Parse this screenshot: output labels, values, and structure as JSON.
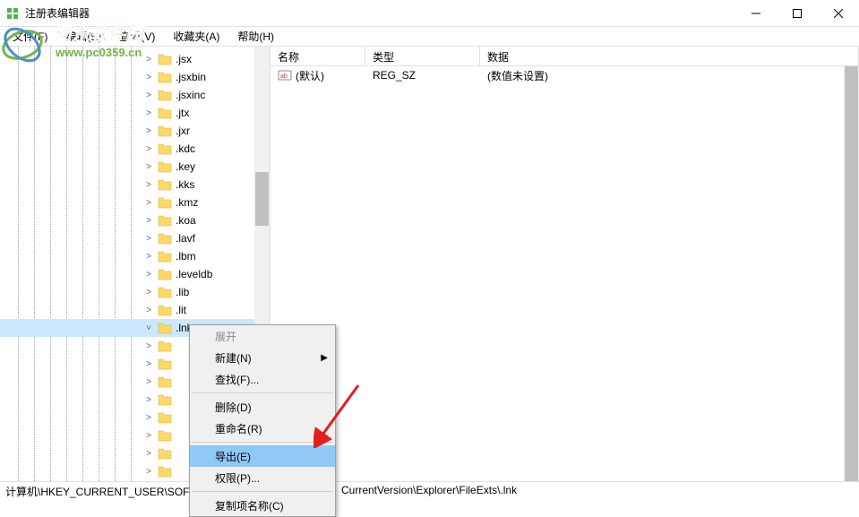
{
  "window": {
    "title": "注册表编辑器"
  },
  "menubar": {
    "file": "文件(F)",
    "edit": "编辑(E)",
    "view": "查看(V)",
    "favorites": "收藏夹(A)",
    "help": "帮助(H)"
  },
  "watermark": {
    "line1": "河东软件园",
    "line2": "www.pc0359.cn"
  },
  "tree": {
    "items": [
      ".jsx",
      ".jsxbin",
      ".jsxinc",
      ".jtx",
      ".jxr",
      ".kdc",
      ".key",
      ".kks",
      ".kmz",
      ".koa",
      ".lavf",
      ".lbm",
      ".leveldb",
      ".lib",
      ".lit",
      ".lnk"
    ],
    "selected": ".lnk",
    "hidden_count": 8
  },
  "list": {
    "headers": {
      "name": "名称",
      "type": "类型",
      "data": "数据"
    },
    "rows": [
      {
        "name": "(默认)",
        "type": "REG_SZ",
        "data": "(数值未设置)"
      }
    ]
  },
  "context_menu": {
    "expand": "展开",
    "new": "新建(N)",
    "find": "查找(F)...",
    "delete": "删除(D)",
    "rename": "重命名(R)",
    "export": "导出(E)",
    "permissions": "权限(P)...",
    "copy_key_name": "复制项名称(C)"
  },
  "statusbar": {
    "left": "计算机\\HKEY_CURRENT_USER\\SOFT",
    "right": "CurrentVersion\\Explorer\\FileExts\\.lnk"
  }
}
